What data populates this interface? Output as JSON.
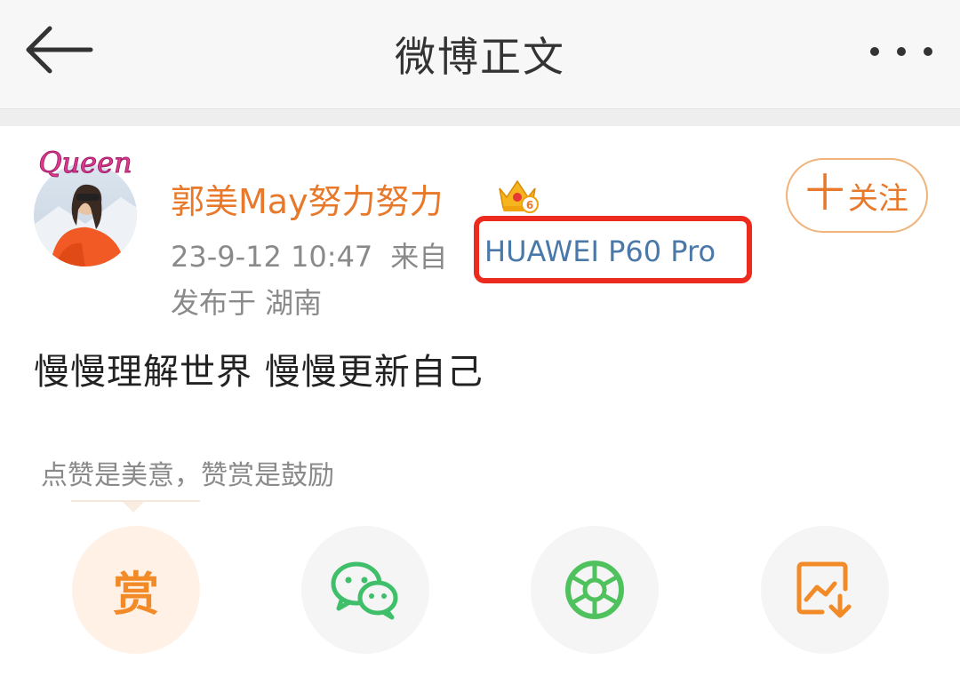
{
  "nav": {
    "title": "微博正文",
    "back_icon": "back-arrow-icon",
    "more_icon": "more-dots-icon"
  },
  "post": {
    "avatar_badge_text": "Queen",
    "username": "郭美May努力努力",
    "vip_level": "6",
    "follow_label": "关注",
    "follow_plus": "十",
    "timestamp": "23-9-12 10:47",
    "from_label": "来自",
    "device": "HUAWEI P60 Pro",
    "location": "发布于 湖南",
    "text": "慢慢理解世界 慢慢更新自己"
  },
  "reward": {
    "tip": "点赞是美意，赞赏是鼓励"
  },
  "actions": [
    {
      "id": "reward",
      "label": "赏",
      "icon": "reward-icon"
    },
    {
      "id": "wechat",
      "icon": "wechat-icon"
    },
    {
      "id": "moments",
      "icon": "moments-icon"
    },
    {
      "id": "save-image",
      "icon": "save-image-icon"
    }
  ],
  "colors": {
    "username": "#e8792b",
    "device_link": "#4a78a8",
    "highlight_box": "#ec2a1e",
    "wechat": "#3fbf6a",
    "moments": "#4fc25e",
    "reward": "#f28a27"
  }
}
